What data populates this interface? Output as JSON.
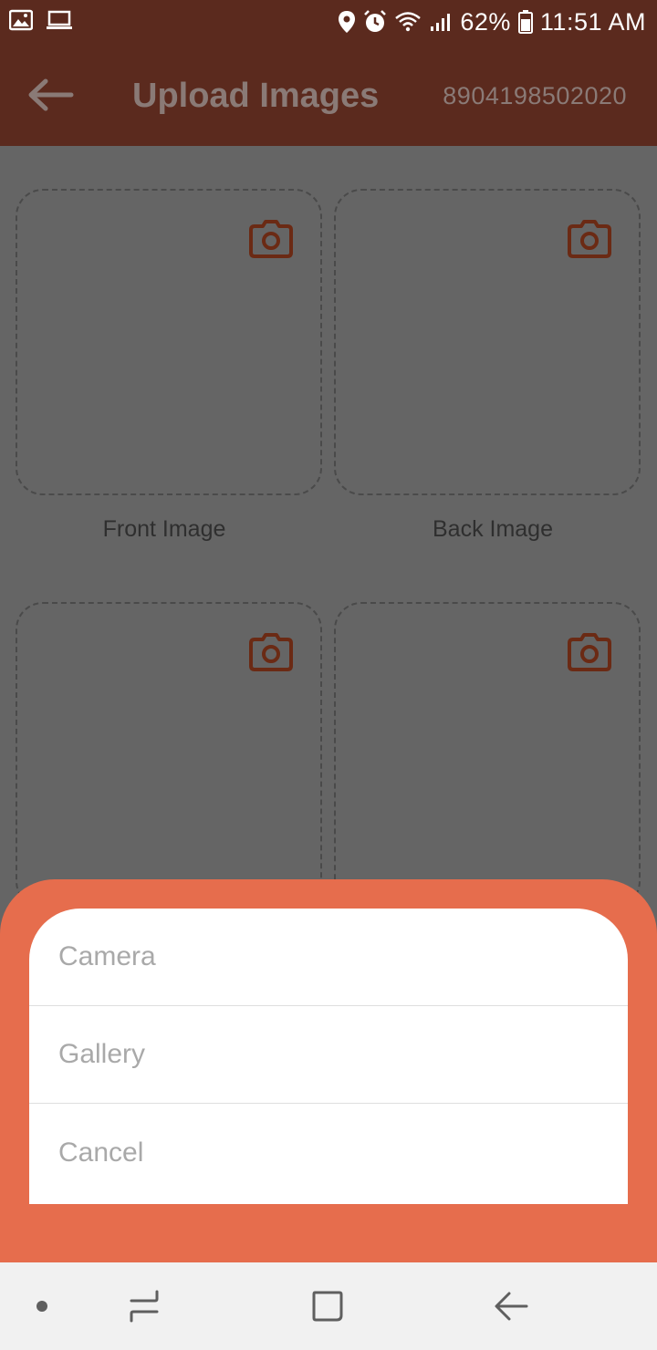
{
  "status_bar": {
    "battery": "62%",
    "time": "11:51 AM",
    "icons": [
      "gallery-icon",
      "laptop-icon",
      "location-icon",
      "alarm-icon",
      "wifi-icon",
      "signal-icon",
      "battery-icon"
    ]
  },
  "app_bar": {
    "title": "Upload Images",
    "subtitle": "8904198502020",
    "back_icon": "back-arrow-icon"
  },
  "upload_tiles": [
    {
      "label": "Front Image",
      "icon": "camera-icon"
    },
    {
      "label": "Back Image",
      "icon": "camera-icon"
    },
    {
      "label": "",
      "icon": "camera-icon"
    },
    {
      "label": "",
      "icon": "camera-icon"
    }
  ],
  "bottom_sheet": {
    "options": [
      {
        "label": "Camera"
      },
      {
        "label": "Gallery"
      },
      {
        "label": "Cancel"
      }
    ]
  },
  "nav_bar": {
    "icons": [
      "dot-icon",
      "recents-icon",
      "home-icon",
      "back-icon"
    ]
  },
  "colors": {
    "app_bar": "#5b2a1e",
    "accent": "#e66d4d",
    "scrim": "#656565",
    "camera_icon": "#6b2a14"
  }
}
